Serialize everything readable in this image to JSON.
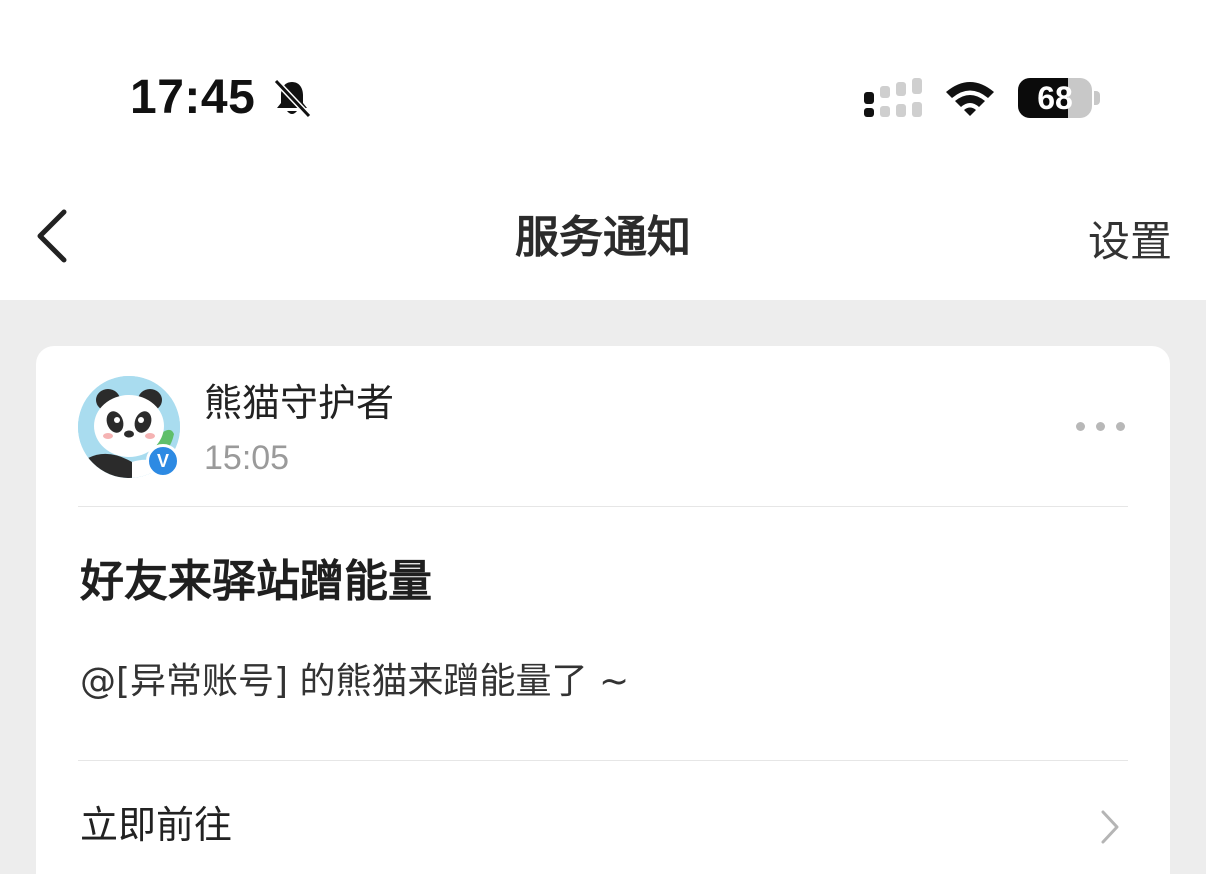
{
  "status_bar": {
    "time": "17:45",
    "battery_level": "68",
    "battery_percent": 68
  },
  "nav": {
    "title": "服务通知",
    "settings_label": "设置"
  },
  "message": {
    "sender": "熊猫守护者",
    "time": "15:05",
    "verified_mark": "V",
    "title": "好友来驿站蹭能量",
    "body": "@[异常账号] 的熊猫来蹭能量了 ~",
    "action_label": "立即前往"
  },
  "colors": {
    "page_background": "#ededed",
    "card_background": "#ffffff",
    "verified_badge": "#2d8ae3",
    "muted_text": "#9a9a9a"
  },
  "icons": [
    "bell-slash-icon",
    "cellular-signal-icon",
    "wifi-icon",
    "battery-icon",
    "chevron-left-icon",
    "more-dots-icon",
    "chevron-right-icon",
    "panda-avatar"
  ]
}
